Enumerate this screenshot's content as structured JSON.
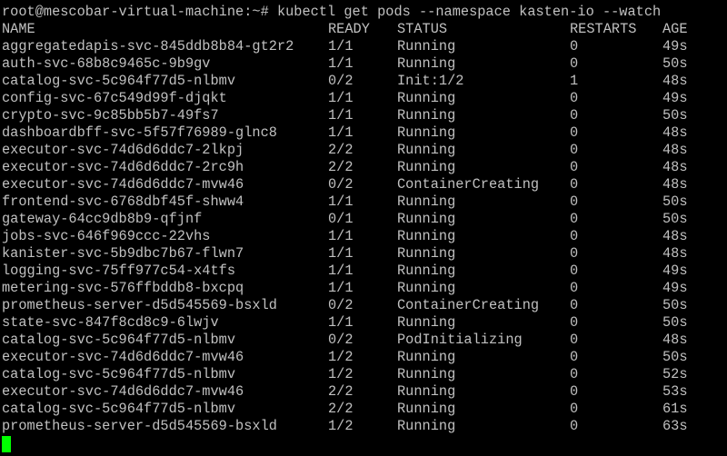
{
  "terminal": {
    "prompt": "root@mescobar-virtual-machine:~# ",
    "command": "kubectl get pods --namespace kasten-io --watch",
    "cursor_color": "#00ff00",
    "text_color": "#c0c0c0",
    "background_color": "#000000",
    "headers": {
      "name": "NAME",
      "ready": "READY",
      "status": "STATUS",
      "restarts": "RESTARTS",
      "age": "AGE"
    },
    "rows": [
      {
        "name": "aggregatedapis-svc-845ddb8b84-gt2r2",
        "ready": "1/1",
        "status": "Running",
        "restarts": "0",
        "age": "49s"
      },
      {
        "name": "auth-svc-68b8c9465c-9b9gv",
        "ready": "1/1",
        "status": "Running",
        "restarts": "0",
        "age": "50s"
      },
      {
        "name": "catalog-svc-5c964f77d5-nlbmv",
        "ready": "0/2",
        "status": "Init:1/2",
        "restarts": "1",
        "age": "48s"
      },
      {
        "name": "config-svc-67c549d99f-djqkt",
        "ready": "1/1",
        "status": "Running",
        "restarts": "0",
        "age": "49s"
      },
      {
        "name": "crypto-svc-9c85bb5b7-49fs7",
        "ready": "1/1",
        "status": "Running",
        "restarts": "0",
        "age": "50s"
      },
      {
        "name": "dashboardbff-svc-5f57f76989-glnc8",
        "ready": "1/1",
        "status": "Running",
        "restarts": "0",
        "age": "48s"
      },
      {
        "name": "executor-svc-74d6d6ddc7-2lkpj",
        "ready": "2/2",
        "status": "Running",
        "restarts": "0",
        "age": "48s"
      },
      {
        "name": "executor-svc-74d6d6ddc7-2rc9h",
        "ready": "2/2",
        "status": "Running",
        "restarts": "0",
        "age": "48s"
      },
      {
        "name": "executor-svc-74d6d6ddc7-mvw46",
        "ready": "0/2",
        "status": "ContainerCreating",
        "restarts": "0",
        "age": "48s"
      },
      {
        "name": "frontend-svc-6768dbf45f-shww4",
        "ready": "1/1",
        "status": "Running",
        "restarts": "0",
        "age": "50s"
      },
      {
        "name": "gateway-64cc9db8b9-qfjnf",
        "ready": "0/1",
        "status": "Running",
        "restarts": "0",
        "age": "50s"
      },
      {
        "name": "jobs-svc-646f969ccc-22vhs",
        "ready": "1/1",
        "status": "Running",
        "restarts": "0",
        "age": "48s"
      },
      {
        "name": "kanister-svc-5b9dbc7b67-flwn7",
        "ready": "1/1",
        "status": "Running",
        "restarts": "0",
        "age": "48s"
      },
      {
        "name": "logging-svc-75ff977c54-x4tfs",
        "ready": "1/1",
        "status": "Running",
        "restarts": "0",
        "age": "49s"
      },
      {
        "name": "metering-svc-576ffbddb8-bxcpq",
        "ready": "1/1",
        "status": "Running",
        "restarts": "0",
        "age": "49s"
      },
      {
        "name": "prometheus-server-d5d545569-bsxld",
        "ready": "0/2",
        "status": "ContainerCreating",
        "restarts": "0",
        "age": "50s"
      },
      {
        "name": "state-svc-847f8cd8c9-6lwjv",
        "ready": "1/1",
        "status": "Running",
        "restarts": "0",
        "age": "50s"
      },
      {
        "name": "catalog-svc-5c964f77d5-nlbmv",
        "ready": "0/2",
        "status": "PodInitializing",
        "restarts": "0",
        "age": "48s"
      },
      {
        "name": "executor-svc-74d6d6ddc7-mvw46",
        "ready": "1/2",
        "status": "Running",
        "restarts": "0",
        "age": "50s"
      },
      {
        "name": "catalog-svc-5c964f77d5-nlbmv",
        "ready": "1/2",
        "status": "Running",
        "restarts": "0",
        "age": "52s"
      },
      {
        "name": "executor-svc-74d6d6ddc7-mvw46",
        "ready": "2/2",
        "status": "Running",
        "restarts": "0",
        "age": "53s"
      },
      {
        "name": "catalog-svc-5c964f77d5-nlbmv",
        "ready": "2/2",
        "status": "Running",
        "restarts": "0",
        "age": "61s"
      },
      {
        "name": "prometheus-server-d5d545569-bsxld",
        "ready": "1/2",
        "status": "Running",
        "restarts": "0",
        "age": "63s"
      }
    ]
  }
}
